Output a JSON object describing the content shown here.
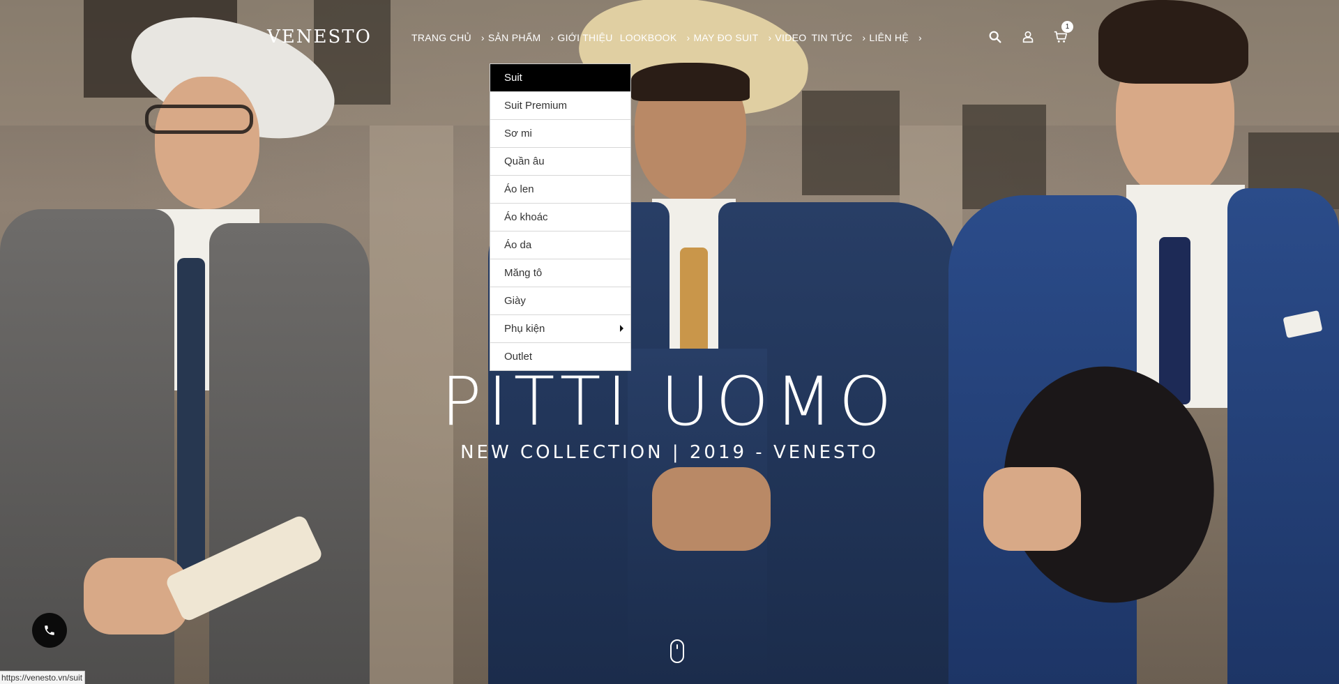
{
  "brand": {
    "logo_text": "VENESTO"
  },
  "nav": {
    "items": [
      {
        "label": "TRANG CHỦ"
      },
      {
        "label": "SẢN PHẨM"
      },
      {
        "label": "GIỚI THIỆU"
      },
      {
        "label": "LOOKBOOK"
      },
      {
        "label": "MAY ĐO SUIT"
      },
      {
        "label": "VIDEO"
      },
      {
        "label": "TIN TỨC"
      },
      {
        "label": "LIÊN HỆ"
      }
    ]
  },
  "header_icons": {
    "search_icon": "search-icon",
    "account_icon": "user-icon",
    "cart_icon": "cart-icon",
    "cart_count": "1"
  },
  "dropdown": {
    "items": [
      {
        "label": "Suit",
        "active": true
      },
      {
        "label": "Suit Premium"
      },
      {
        "label": "Sơ mi"
      },
      {
        "label": "Quần âu"
      },
      {
        "label": "Áo len"
      },
      {
        "label": "Áo khoác"
      },
      {
        "label": "Áo da"
      },
      {
        "label": "Măng tô"
      },
      {
        "label": "Giày"
      },
      {
        "label": "Phụ kiện",
        "has_submenu": true
      },
      {
        "label": "Outlet"
      }
    ]
  },
  "hero": {
    "title": "PITTI UOMO",
    "subtitle": "NEW COLLECTION | 2019 - VENESTO"
  },
  "floating": {
    "phone_icon": "phone-icon",
    "scroll_icon": "scroll-mouse-icon"
  },
  "status_bar": {
    "url": "https://venesto.vn/suit"
  },
  "colors": {
    "dropdown_active_bg": "#000000",
    "text_white": "#ffffff"
  }
}
